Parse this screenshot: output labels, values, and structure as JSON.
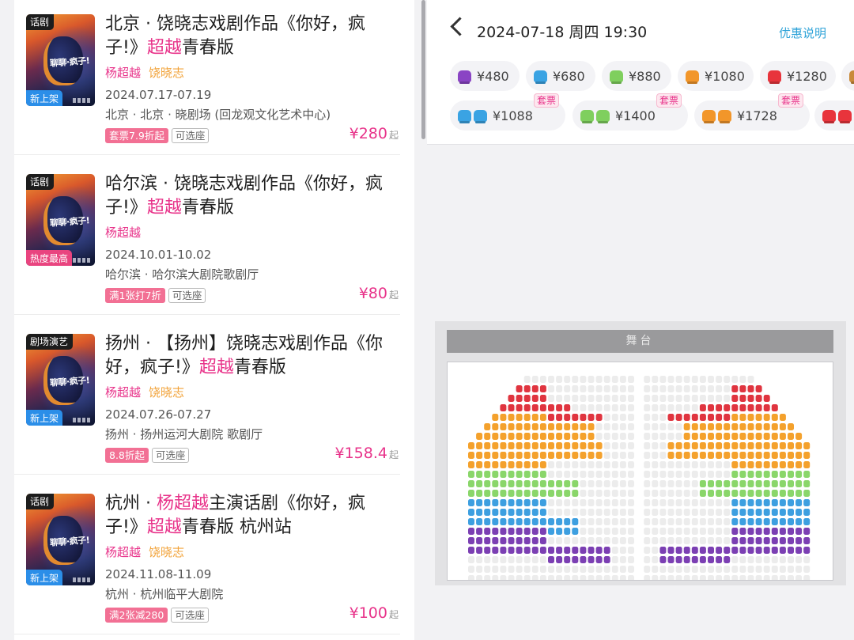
{
  "shows": [
    {
      "poster_tag": "话剧",
      "poster_badge": "新上架",
      "poster_title": "聊聊·疯子!",
      "title_pre": "北京 · 饶晓志戏剧作品《你好，疯子!》",
      "title_hl": "超越",
      "title_post": "青春版",
      "cast": [
        "杨超越",
        "饶晓志"
      ],
      "date": "2024.07.17-07.19",
      "venue": "北京 · 北京 · 晓剧场 (回龙观文化艺术中心)",
      "badges": [
        "套票7.9折起",
        "可选座"
      ],
      "price": "¥280",
      "price_suffix": "起"
    },
    {
      "poster_tag": "话剧",
      "poster_badge": "热度最高",
      "poster_title": "聊聊·疯子!",
      "title_pre": "哈尔滨 · 饶晓志戏剧作品《你好，疯子!》",
      "title_hl": "超越",
      "title_post": "青春版",
      "cast": [
        "杨超越"
      ],
      "date": "2024.10.01-10.02",
      "venue": "哈尔滨 · 哈尔滨大剧院歌剧厅",
      "badges": [
        "满1张打7折",
        "可选座"
      ],
      "price": "¥80",
      "price_suffix": "起"
    },
    {
      "poster_tag": "剧场演艺",
      "poster_badge": "新上架",
      "poster_title": "聊聊·疯子!",
      "title_pre": "扬州 · 【扬州】饶晓志戏剧作品《你好，疯子!》",
      "title_hl": "超越",
      "title_post": "青春版",
      "cast": [
        "杨超越",
        "饶晓志"
      ],
      "date": "2024.07.26-07.27",
      "venue": "扬州 · 扬州运河大剧院 歌剧厅",
      "badges": [
        "8.8折起",
        "可选座"
      ],
      "price": "¥158.4",
      "price_suffix": "起"
    },
    {
      "poster_tag": "话剧",
      "poster_badge": "新上架",
      "poster_title": "聊聊·疯子!",
      "title_pre": "杭州 · ",
      "title_hl_a": "杨超越",
      "title_mid": "主演话剧《你好，疯子!》",
      "title_hl": "超越",
      "title_post": "青春版 杭州站",
      "cast": [
        "杨超越",
        "饶晓志"
      ],
      "date": "2024.11.08-11.09",
      "venue": "杭州 · 杭州临平大剧院",
      "badges": [
        "满2张减280",
        "可选座"
      ],
      "price": "¥100",
      "price_suffix": "起"
    }
  ],
  "session": {
    "datetime": "2024-07-18 周四 19:30",
    "promo_link": "优惠说明"
  },
  "price_chips_row1": [
    {
      "label": "¥480",
      "color": "#8a44c4"
    },
    {
      "label": "¥680",
      "color": "#3aa3e3"
    },
    {
      "label": "¥880",
      "color": "#7fcf5e"
    },
    {
      "label": "¥1080",
      "color": "#f2962a"
    },
    {
      "label": "¥1280",
      "color": "#e8343c"
    },
    {
      "label": "",
      "color": "#c98a3a"
    }
  ],
  "price_chips_row2": [
    {
      "label": "¥1088",
      "color": "#3aa3e3",
      "package": "套票"
    },
    {
      "label": "¥1400",
      "color": "#7fcf5e",
      "package": "套票"
    },
    {
      "label": "¥1728",
      "color": "#f2962a",
      "package": "套票"
    },
    {
      "label": "",
      "color": "#e8343c",
      "package": ""
    }
  ],
  "stage_label": "舞台",
  "seat_colors": {
    "purple": "#7b3fb3",
    "blue": "#3d9fe0",
    "green": "#8ad66a",
    "orange": "#f4a12c",
    "red": "#e0343f",
    "empty": "#ececec"
  }
}
